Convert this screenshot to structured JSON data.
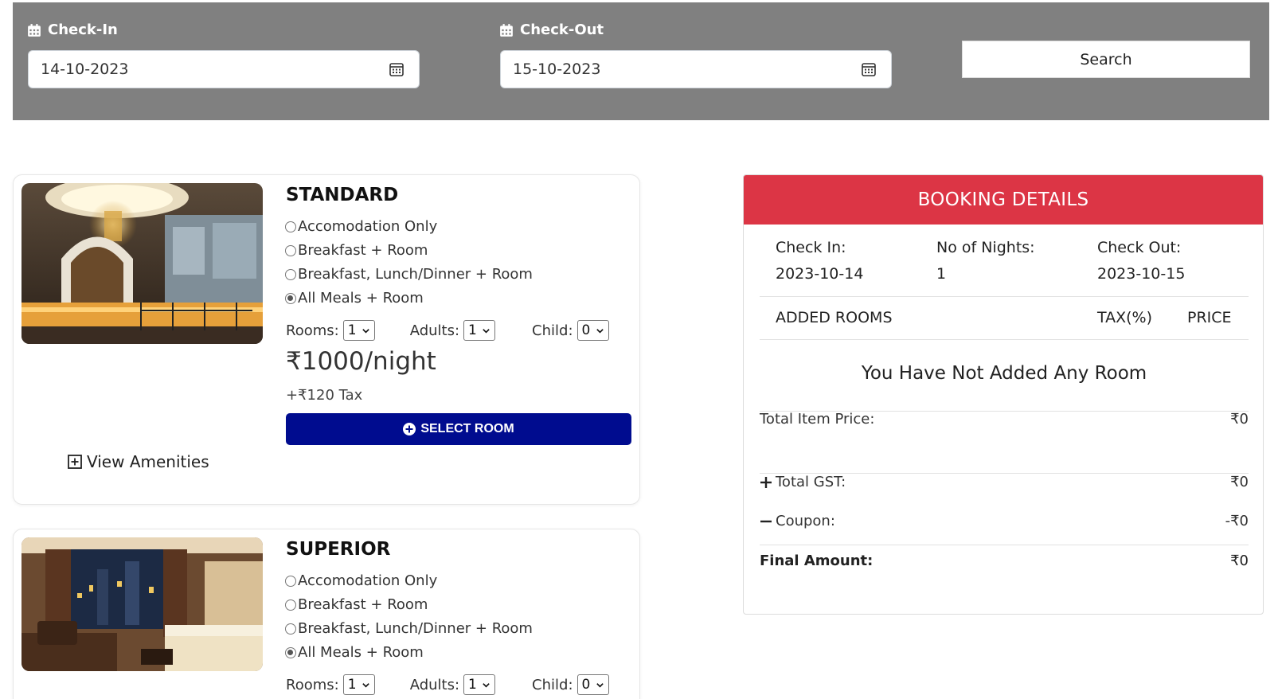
{
  "search": {
    "checkin_label": "Check-In",
    "checkin_value": "14-10-2023",
    "checkout_label": "Check-Out",
    "checkout_value": "15-10-2023",
    "search_label": "Search"
  },
  "rooms": [
    {
      "name": "STANDARD",
      "options": [
        "Accomodation Only",
        "Breakfast + Room",
        "Breakfast, Lunch/Dinner + Room",
        "All Meals + Room"
      ],
      "selected_option": 3,
      "rooms_label": "Rooms:",
      "rooms_value": "1",
      "adults_label": "Adults:",
      "adults_value": "1",
      "child_label": "Child:",
      "child_value": "0",
      "price": "₹1000/night",
      "tax": "+₹120 Tax",
      "select_label": "SELECT ROOM",
      "amenities_label": "View Amenities"
    },
    {
      "name": "SUPERIOR",
      "options": [
        "Accomodation Only",
        "Breakfast + Room",
        "Breakfast, Lunch/Dinner + Room",
        "All Meals + Room"
      ],
      "selected_option": 3,
      "rooms_label": "Rooms:",
      "rooms_value": "1",
      "adults_label": "Adults:",
      "adults_value": "1",
      "child_label": "Child:",
      "child_value": "0"
    }
  ],
  "booking": {
    "title": "BOOKING DETAILS",
    "checkin_label": "Check In:",
    "checkin_value": "2023-10-14",
    "nights_label": "No of Nights:",
    "nights_value": "1",
    "checkout_label": "Check Out:",
    "checkout_value": "2023-10-15",
    "col_rooms": "ADDED ROOMS",
    "col_tax": "TAX(%)",
    "col_price": "PRICE",
    "empty_message": "You Have Not Added Any Room",
    "total_item_label": "Total Item Price:",
    "total_item_value": "₹0",
    "gst_label": "Total GST:",
    "gst_value": "₹0",
    "coupon_label": "Coupon:",
    "coupon_value": "-₹0",
    "final_label": "Final Amount:",
    "final_value": "₹0"
  },
  "colors": {
    "search_bar_bg": "#808080",
    "booking_header": "#dc3545",
    "select_button": "#000c8f"
  }
}
